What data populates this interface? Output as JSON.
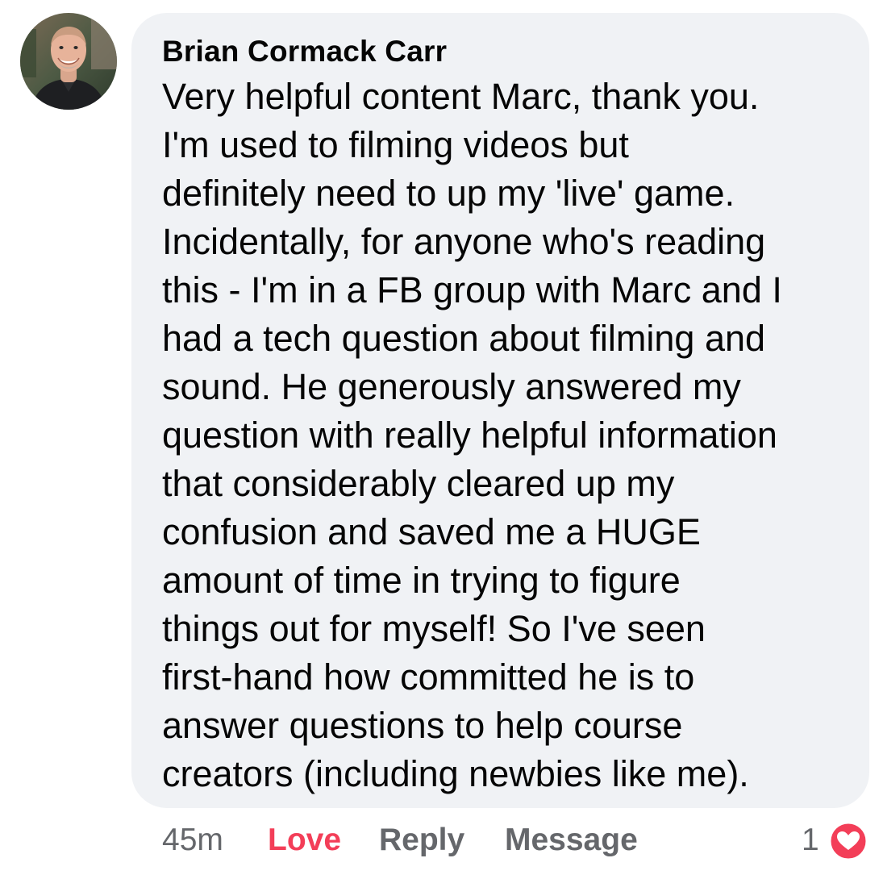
{
  "comment": {
    "author": "Brian Cormack Carr",
    "lines": [
      "Very helpful content Marc, thank you.",
      "I'm used to filming videos but",
      "definitely need to up my 'live' game.",
      "Incidentally, for anyone who's reading",
      "this - I'm in a FB group with Marc and I",
      "had a tech question about filming and",
      "sound. He generously answered my",
      "question with really helpful information",
      "that considerably cleared up my",
      "confusion and saved me a HUGE",
      "amount of time in trying to figure",
      "things out for myself! So I've seen",
      "first-hand how committed he is to",
      "answer questions to help course",
      "creators (including newbies like me)."
    ]
  },
  "actions": {
    "time": "45m",
    "love": "Love",
    "reply": "Reply",
    "message": "Message"
  },
  "reactions": {
    "count": "1",
    "icon": "heart-icon"
  },
  "colors": {
    "love_active": "#f33e58",
    "meta_gray": "#65676b",
    "bubble_bg": "#f0f2f5",
    "text": "#050505"
  }
}
